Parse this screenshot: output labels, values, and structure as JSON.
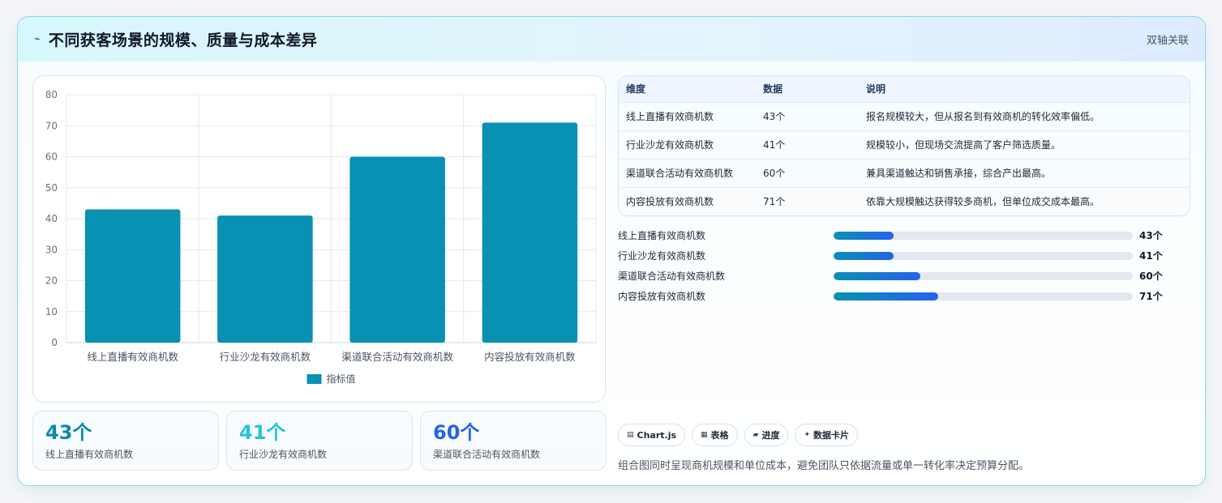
{
  "header": {
    "icon": "sparkline-icon",
    "title": "不同获客场景的规模、质量与成本差异",
    "tag": "双轴关联"
  },
  "chart_data": {
    "type": "bar",
    "categories": [
      "线上直播有效商机数",
      "行业沙龙有效商机数",
      "渠道联合活动有效商机数",
      "内容投放有效商机数"
    ],
    "series": [
      {
        "name": "指标值",
        "values": [
          43,
          41,
          60,
          71
        ],
        "color": "#0891b2"
      }
    ],
    "ylim": [
      0,
      80
    ],
    "yticks": [
      0,
      10,
      20,
      30,
      40,
      50,
      60,
      70,
      80
    ],
    "grid": true,
    "legend": "bottom"
  },
  "stats": [
    {
      "value": "43个",
      "label": "线上直播有效商机数",
      "color": "#0e8aa6"
    },
    {
      "value": "41个",
      "label": "行业沙龙有效商机数",
      "color": "#22c5da"
    },
    {
      "value": "60个",
      "label": "渠道联合活动有效商机数",
      "color": "#2563eb"
    }
  ],
  "table": {
    "headers": [
      "维度",
      "数据",
      "说明"
    ],
    "rows": [
      {
        "dim": "线上直播有效商机数",
        "data": "43个",
        "note": "报名规模较大，但从报名到有效商机的转化效率偏低。"
      },
      {
        "dim": "行业沙龙有效商机数",
        "data": "41个",
        "note": "规模较小，但现场交流提高了客户筛选质量。"
      },
      {
        "dim": "渠道联合活动有效商机数",
        "data": "60个",
        "note": "兼具渠道触达和销售承接，综合产出最高。"
      },
      {
        "dim": "内容投放有效商机数",
        "data": "71个",
        "note": "依靠大规模触达获得较多商机，但单位成交成本最高。"
      }
    ]
  },
  "progress": [
    {
      "label": "线上直播有效商机数",
      "value": "43个",
      "fraction": 0.2
    },
    {
      "label": "行业沙龙有效商机数",
      "value": "41个",
      "fraction": 0.2
    },
    {
      "label": "渠道联合活动有效商机数",
      "value": "60个",
      "fraction": 0.29
    },
    {
      "label": "内容投放有效商机数",
      "value": "71个",
      "fraction": 0.35
    }
  ],
  "chips": [
    {
      "icon": "chart-icon",
      "label": "Chart.js"
    },
    {
      "icon": "table-icon",
      "label": "表格"
    },
    {
      "icon": "progress-icon",
      "label": "进度"
    },
    {
      "icon": "card-icon",
      "label": "数据卡片"
    }
  ],
  "footnote": "组合图同时呈现商机规模和单位成本，避免团队只依据流量或单一转化率决定预算分配。"
}
